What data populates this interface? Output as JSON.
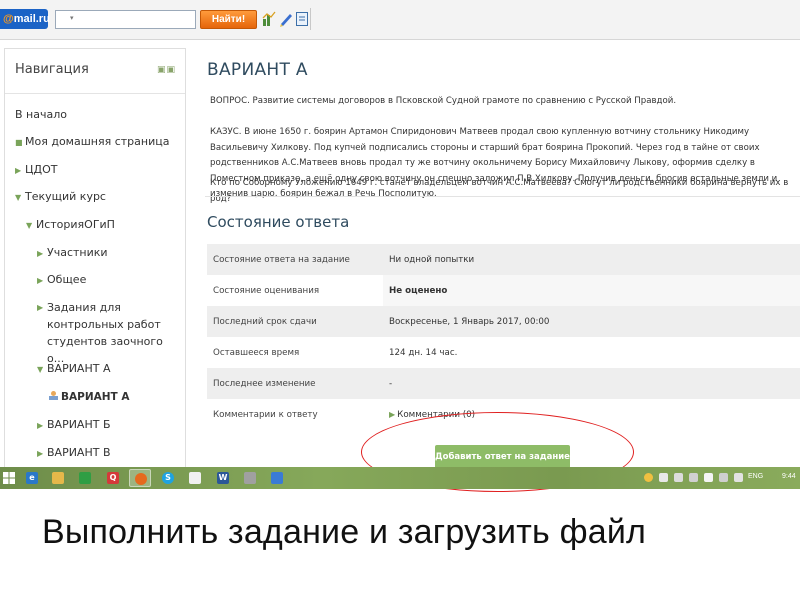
{
  "toolbar": {
    "logo_prefix": "@",
    "logo_text": "mail.ru",
    "search_value": "",
    "find_label": "Найти!"
  },
  "navigation": {
    "title": "Навигация",
    "items": [
      {
        "label": "В начало",
        "marker": ""
      },
      {
        "label": "Моя домашняя страница",
        "marker": "■"
      },
      {
        "label": "ЦДОТ",
        "marker": "▶"
      },
      {
        "label": "Текущий курс",
        "marker": "▼"
      },
      {
        "label": "ИсторияОГиП",
        "marker": "▼"
      },
      {
        "label": "Участники",
        "marker": "▶"
      },
      {
        "label": "Общее",
        "marker": "▶"
      },
      {
        "label": "Задания для контрольных работ студентов заочного о...",
        "marker": "▶"
      },
      {
        "label": "ВАРИАНТ А",
        "marker": "▼"
      },
      {
        "label": "ВАРИАНТ А",
        "marker": ""
      },
      {
        "label": "ВАРИАНТ Б",
        "marker": "▶"
      },
      {
        "label": "ВАРИАНТ В",
        "marker": "▶"
      }
    ]
  },
  "main": {
    "title": "ВАРИАНТ А",
    "question": "ВОПРОС. Развитие системы договоров в Псковской Судной грамоте по сравнению с Русской Правдой.",
    "case": "КАЗУС. В июне 1650 г. боярин Артамон Спиридонович Матвеев продал свою купленную вотчину стольнику Никодиму Васильевичу Хилкову. Под купчей подписались стороны и старший брат боярина Прокопий. Через год в тайне от своих родственников А.С.Матвеев вновь продал ту же вотчину окольничему Борису Михайловичу Лыкову, оформив сделку в Поместном приказе, а ещё одну свою вотчину он спешно заложил П.В.Хилкову. Получив деньги, бросив остальные земли и изменив царю, боярин бежал в Речь Посполитую.",
    "ask": "Кто по Соборному Уложению 1649 г. станет владельцем вотчин А.С.Матвеева? Смогут ли родственники боярина вернуть их в род?",
    "section_title": "Состояние ответа",
    "status_rows": [
      {
        "label": "Состояние ответа на задание",
        "value": "Ни одной попытки"
      },
      {
        "label": "Состояние оценивания",
        "value": "Не оценено"
      },
      {
        "label": "Последний срок сдачи",
        "value": "Воскресенье, 1 Январь 2017, 00:00"
      },
      {
        "label": "Оставшееся время",
        "value": "124 дн. 14 час."
      },
      {
        "label": "Последнее изменение",
        "value": "-"
      },
      {
        "label": "Комментарии к ответу",
        "value": "Комментарии (0)"
      }
    ],
    "submit_label": "Добавить ответ на задание"
  },
  "taskbar": {
    "language": "ENG",
    "time": "9:44"
  },
  "caption": "Выполнить задание и загрузить файл",
  "colors": {
    "accent_green": "#8ebc67",
    "highlight_ellipse": "#e02020",
    "heading": "#2f4b5f",
    "find_button": "#f07a1e"
  }
}
